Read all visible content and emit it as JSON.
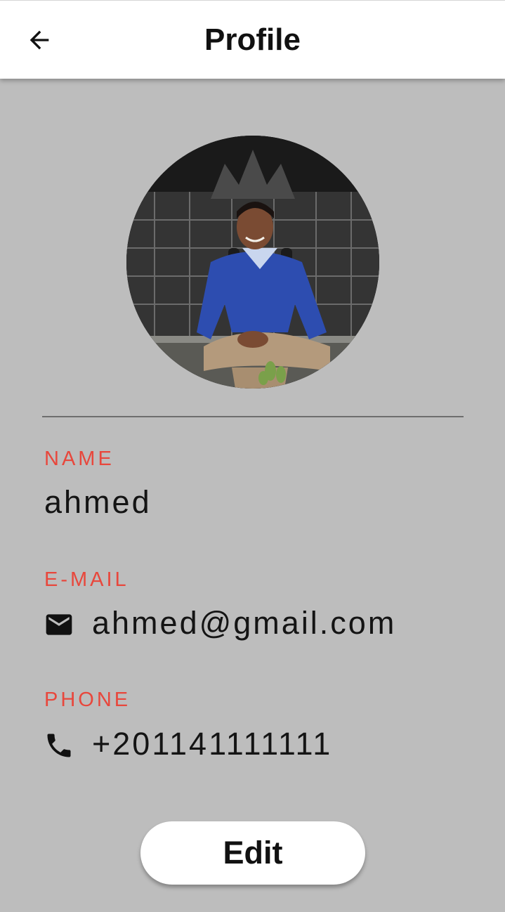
{
  "header": {
    "title": "Profile",
    "back_icon": "arrow-back-icon"
  },
  "profile": {
    "avatar": "profile-photo",
    "fields": {
      "name": {
        "label": "NAME",
        "value": "ahmed"
      },
      "email": {
        "label": "E-MAIL",
        "value": "ahmed@gmail.com",
        "icon": "mail-icon"
      },
      "phone": {
        "label": "PHONE",
        "value": "+201141111111",
        "icon": "phone-icon"
      }
    }
  },
  "actions": {
    "edit_label": "Edit"
  },
  "colors": {
    "background": "#bdbdbd",
    "label": "#e8473c",
    "appbar": "#ffffff",
    "text": "#141414"
  }
}
